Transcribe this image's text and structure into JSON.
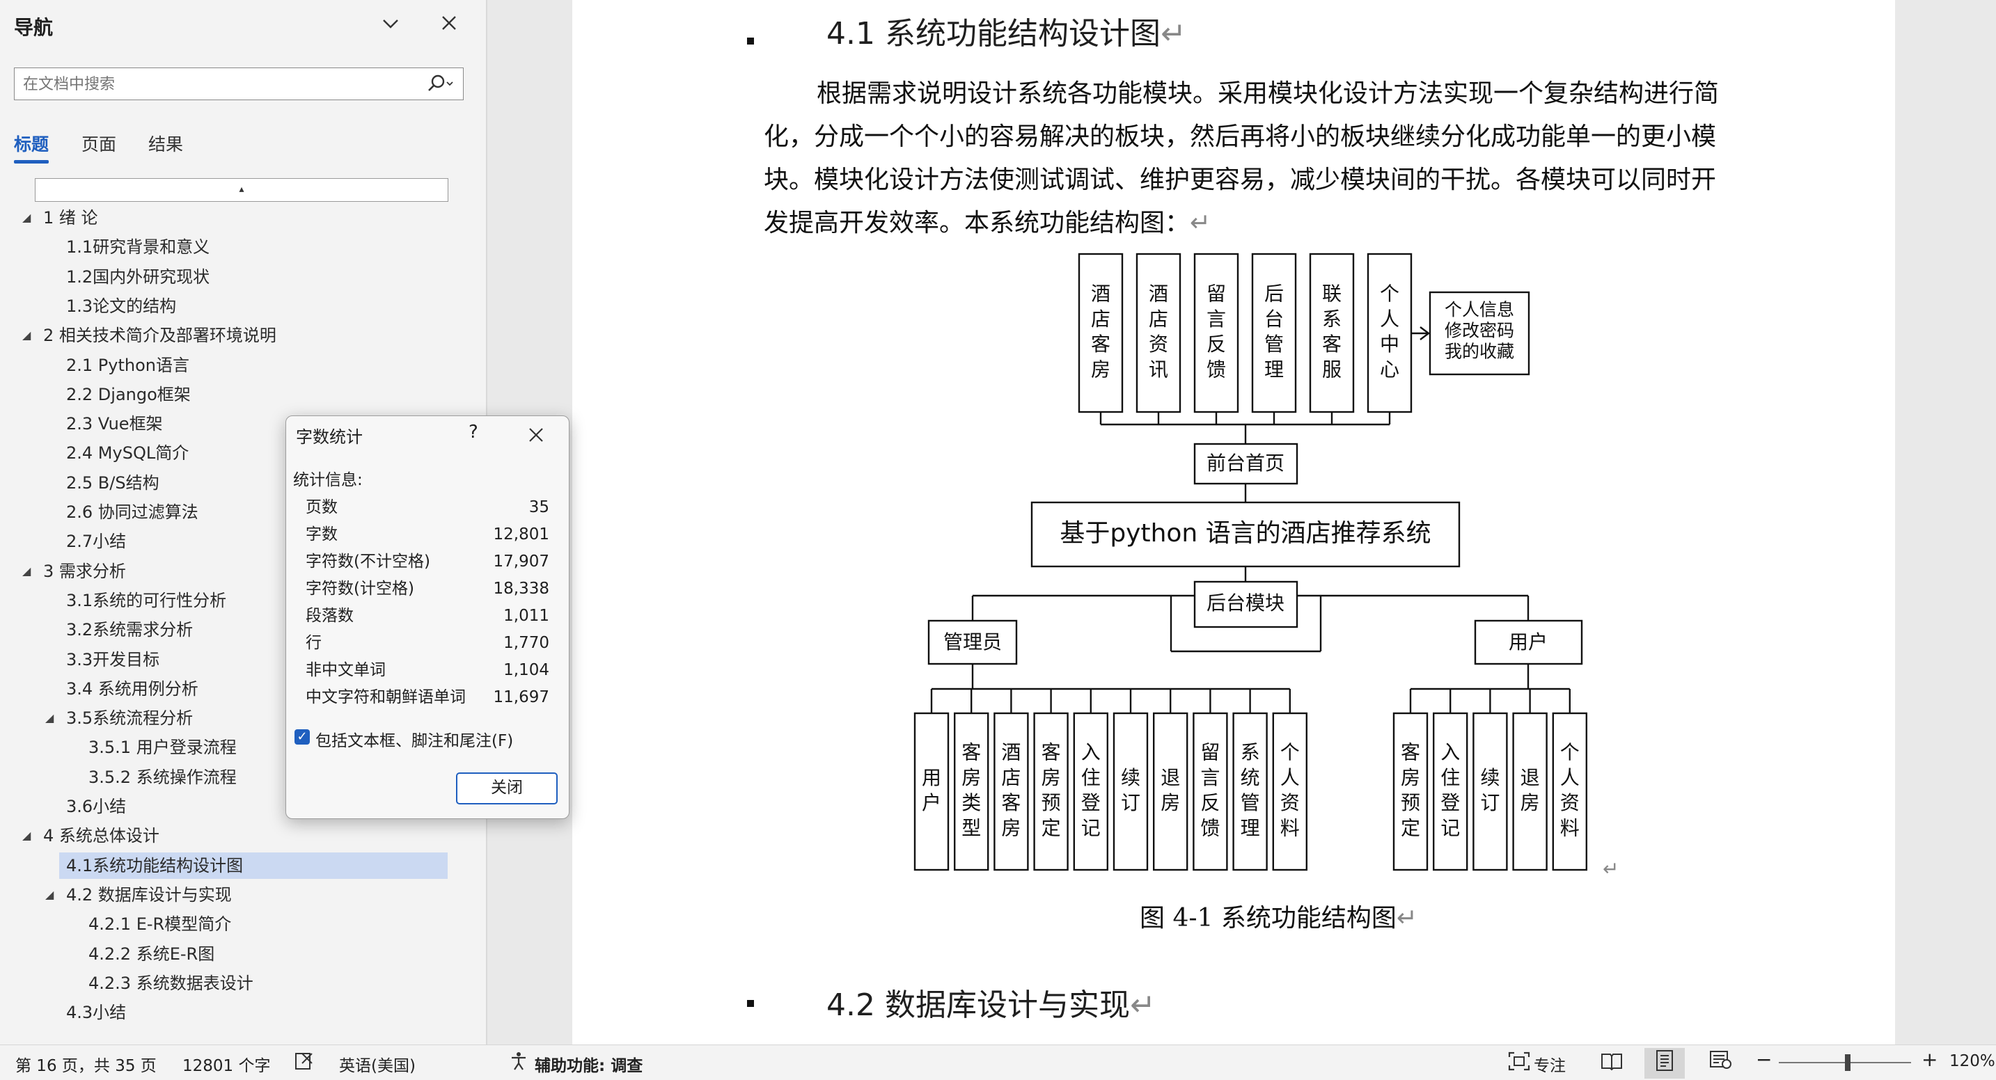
{
  "nav": {
    "title": "导航",
    "search_placeholder": "在文档中搜索",
    "tabs": [
      {
        "label": "标题"
      },
      {
        "label": "页面"
      },
      {
        "label": "结果"
      }
    ],
    "collapse_marker": "▴",
    "tree": [
      {
        "label": "1 绪  论"
      },
      {
        "label": "1.1研究背景和意义"
      },
      {
        "label": "1.2国内外研究现状"
      },
      {
        "label": "1.3论文的结构"
      },
      {
        "label": "2 相关技术简介及部署环境说明"
      },
      {
        "label": "2.1 Python语言"
      },
      {
        "label": "2.2 Django框架"
      },
      {
        "label": "2.3 Vue框架"
      },
      {
        "label": "2.4 MySQL简介"
      },
      {
        "label": "2.5 B/S结构"
      },
      {
        "label": "2.6 协同过滤算法"
      },
      {
        "label": "2.7小结"
      },
      {
        "label": "3 需求分析"
      },
      {
        "label": "3.1系统的可行性分析"
      },
      {
        "label": "3.2系统需求分析"
      },
      {
        "label": "3.3开发目标"
      },
      {
        "label": "3.4 系统用例分析"
      },
      {
        "label": "3.5系统流程分析"
      },
      {
        "label": "3.5.1 用户登录流程"
      },
      {
        "label": "3.5.2 系统操作流程"
      },
      {
        "label": "3.6小结"
      },
      {
        "label": "4 系统总体设计"
      },
      {
        "label": "4.1系统功能结构设计图"
      },
      {
        "label": "4.2 数据库设计与实现"
      },
      {
        "label": "4.2.1  E-R模型简介"
      },
      {
        "label": "4.2.2  系统E-R图"
      },
      {
        "label": "4.2.3 系统数据表设计"
      },
      {
        "label": "4.3小结"
      }
    ]
  },
  "document": {
    "heading_41": "4.1 系统功能结构设计图",
    "paragraph": "根据需求说明设计系统各功能模块。采用模块化设计方法实现一个复杂结构进行简化，分成一个个小的容易解决的板块，然后再将小的板块继续分化成功能单一的更小模块。模块化设计方法使测试调试、维护更容易，减少模块间的干扰。各模块可以同时开发提高开发效率。本系统功能结构图：",
    "caption": "图  4-1 系统功能结构图",
    "heading_42": "4.2  数据库设计与实现",
    "para_mark": "↵",
    "diagram": {
      "top_modules": [
        "酒店客房",
        "酒店资讯",
        "留言反馈",
        "后台管理",
        "联系客服",
        "个人中心"
      ],
      "personal_center_items": [
        "个人信息",
        "修改密码",
        "我的收藏"
      ],
      "front_page": "前台首页",
      "system_name": "基于python 语言的酒店推荐系统",
      "backend_module": "后台模块",
      "admin": "管理员",
      "user": "用户",
      "admin_items": [
        "用户",
        "客房类型",
        "酒店客房",
        "客房预定",
        "入住登记",
        "续订",
        "退房",
        "留言反馈",
        "系统管理",
        "个人资料"
      ],
      "user_items": [
        "客房预定",
        "入住登记",
        "续订",
        "退房",
        "个人资料"
      ]
    }
  },
  "dialog": {
    "title": "字数统计",
    "help": "?",
    "close_x": "✕",
    "section": "统计信息:",
    "stats": [
      {
        "label": "页数",
        "value": "35"
      },
      {
        "label": "字数",
        "value": "12,801"
      },
      {
        "label": "字符数(不计空格)",
        "value": "17,907"
      },
      {
        "label": "字符数(计空格)",
        "value": "18,338"
      },
      {
        "label": "段落数",
        "value": "1,011"
      },
      {
        "label": "行",
        "value": "1,770"
      },
      {
        "label": "非中文单词",
        "value": "1,104"
      },
      {
        "label": "中文字符和朝鲜语单词",
        "value": "11,697"
      }
    ],
    "checkbox_label": "包括文本框、脚注和尾注(F)",
    "checkbox_checked": true,
    "close_button": "关闭"
  },
  "statusbar": {
    "page": "第 16 页，共 35 页",
    "words": "12801 个字",
    "language": "英语(美国)",
    "accessibility": "辅助功能: 调查",
    "focus": "专注",
    "zoom": "120%",
    "zoom_minus": "−",
    "zoom_plus": "+"
  }
}
